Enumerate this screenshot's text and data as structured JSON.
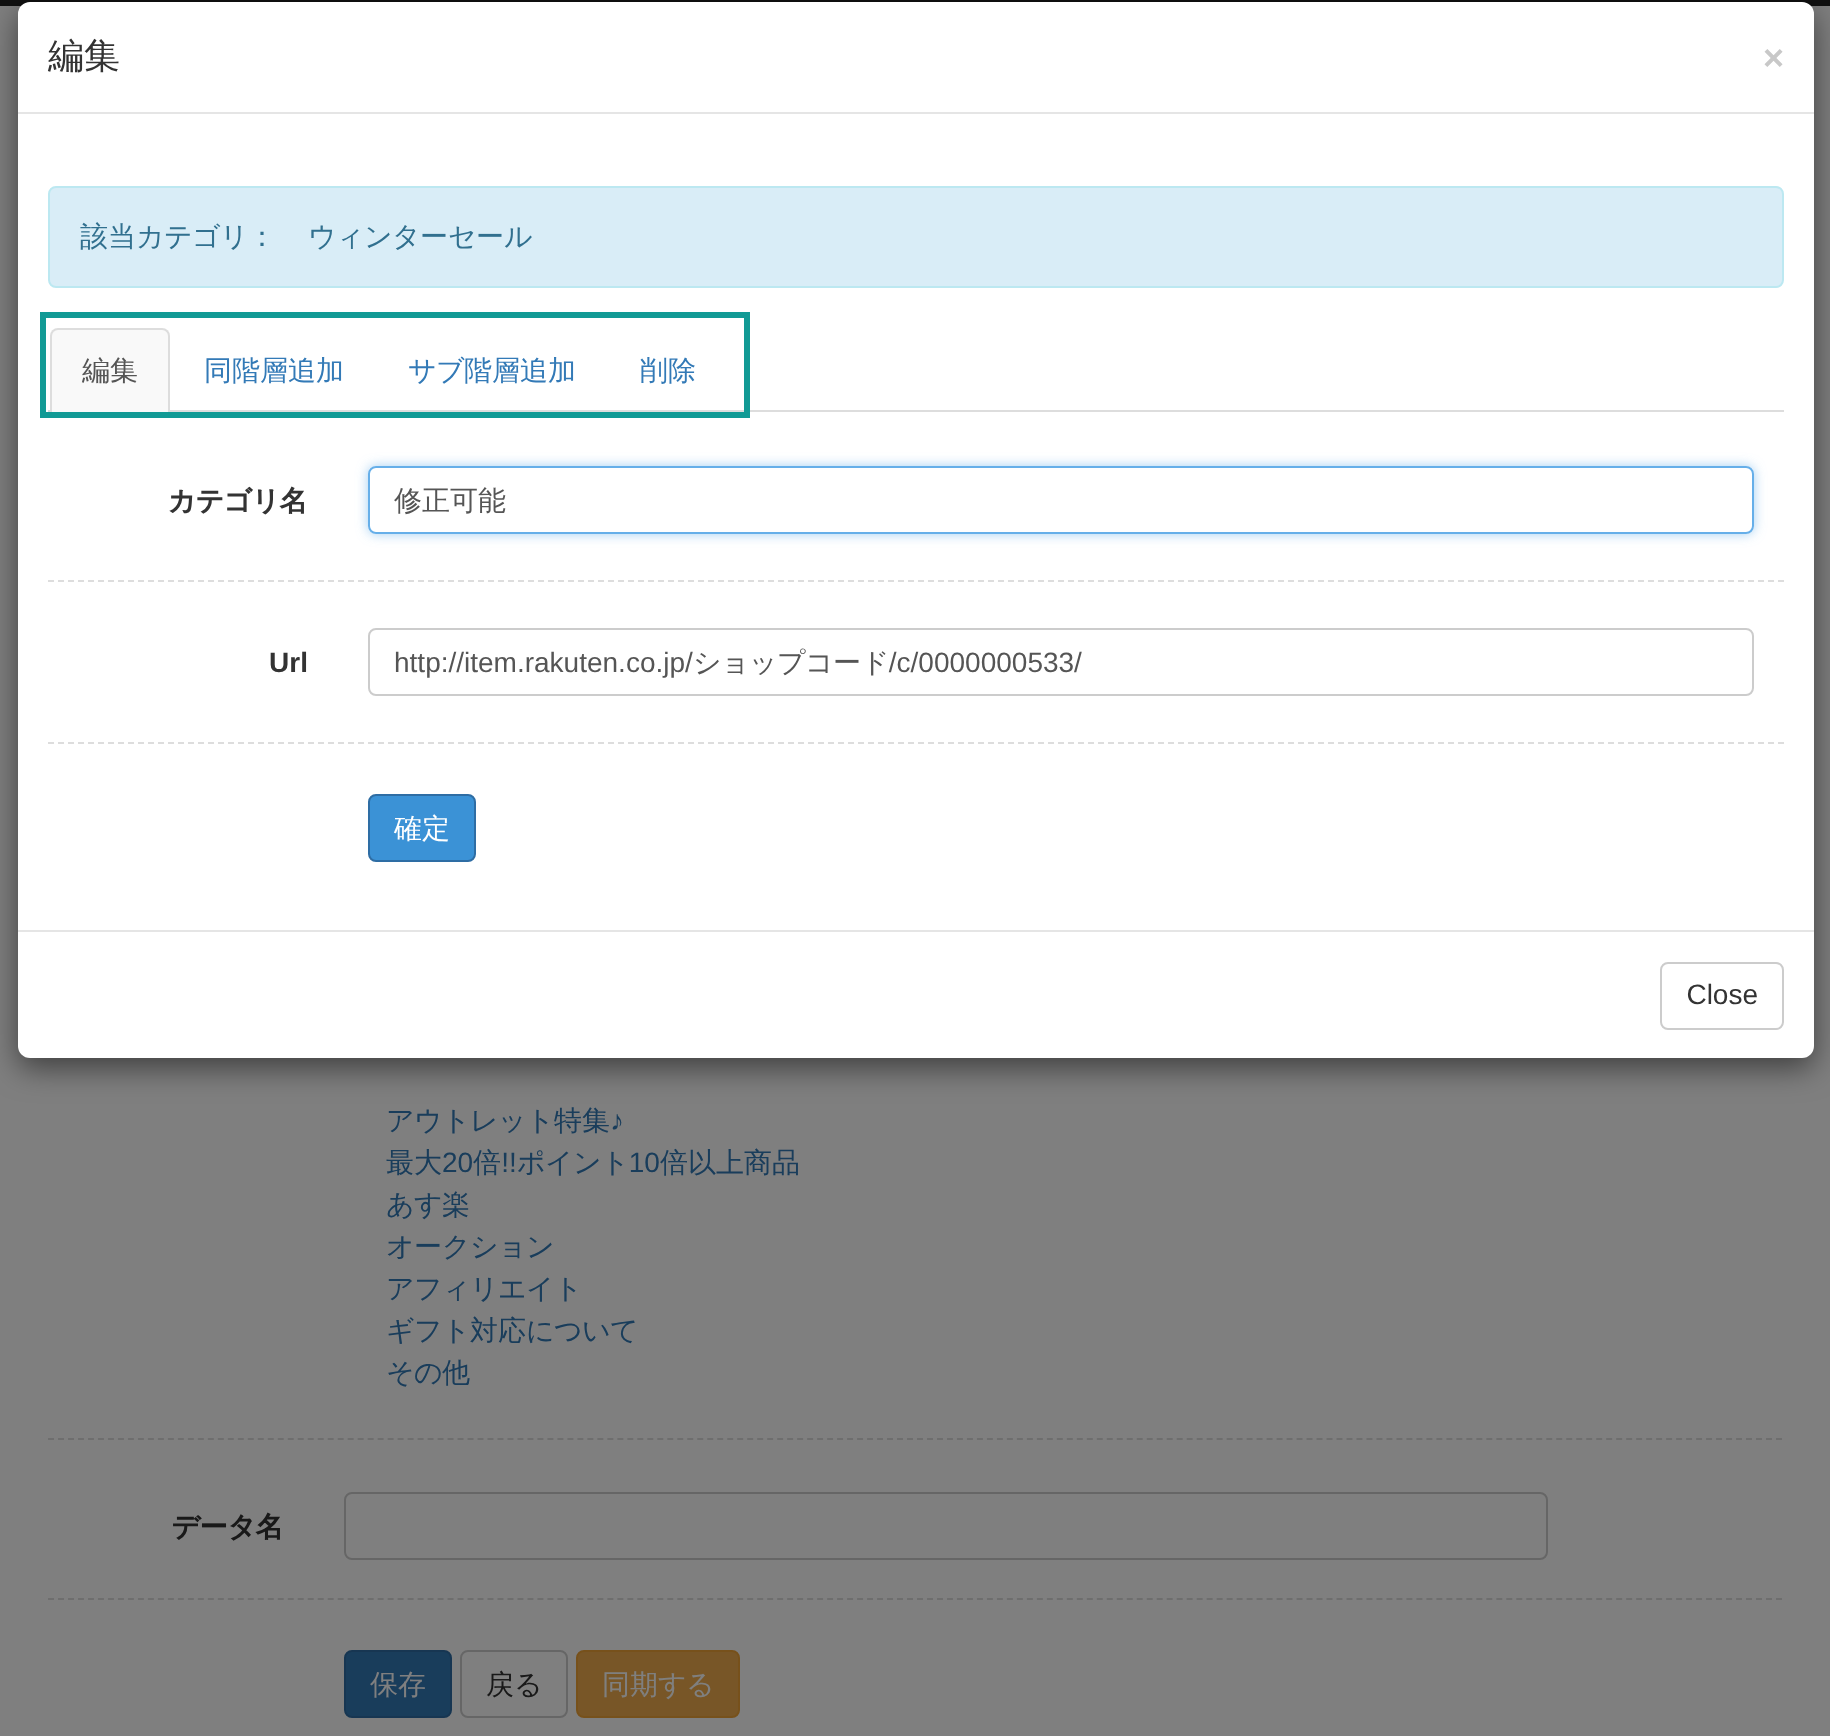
{
  "background_page": {
    "category_links": [
      "アウトレット特集♪",
      "最大20倍!!ポイント10倍以上商品",
      "あす楽",
      "オークション",
      "アフィリエイト",
      "ギフト対応について",
      "その他"
    ],
    "data_name_field": {
      "label": "データ名"
    },
    "buttons": [
      {
        "label": "保存",
        "kind": "primary"
      },
      {
        "label": "戻る",
        "kind": "default"
      },
      {
        "label": "同期する",
        "kind": "warning"
      }
    ]
  },
  "dialog": {
    "title": "編集",
    "close_icon": "×",
    "alert": {
      "label": "該当カテゴリ：",
      "value": "ウィンターセール"
    },
    "tabs": [
      {
        "label": "編集",
        "selected": true
      },
      {
        "label": "同階層追加",
        "selected": false
      },
      {
        "label": "サブ階層追加",
        "selected": false
      },
      {
        "label": "削除",
        "selected": false
      }
    ],
    "tabs_highlighted": true,
    "fields": [
      {
        "label": "カテゴリ名",
        "value": "修正可能",
        "focused": true
      },
      {
        "label": "Url",
        "value": "http://item.rakuten.co.jp/ショップコード/c/0000000533/",
        "focused": false
      }
    ],
    "confirm_button": "確定",
    "footer_button": "Close"
  }
}
